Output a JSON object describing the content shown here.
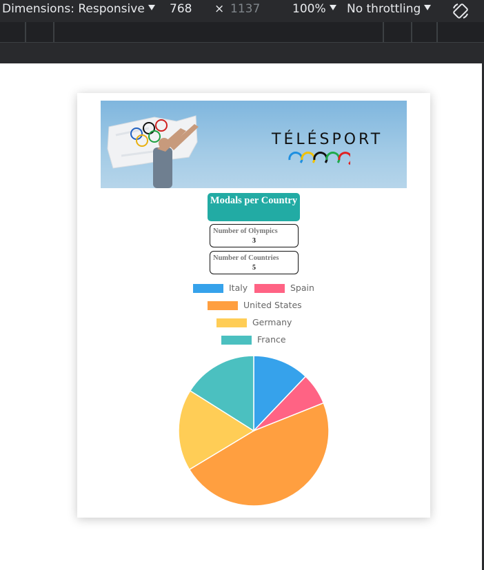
{
  "devtools": {
    "dimensions_label": "Dimensions: Responsive",
    "width": "768",
    "times": "×",
    "height": "1137",
    "zoom": "100%",
    "throttling": "No throttling"
  },
  "banner": {
    "brand": "TÉLÉSPORT"
  },
  "page": {
    "title": "Modals per Country",
    "stats": [
      {
        "label": "Number of Olympics",
        "value": "3"
      },
      {
        "label": "Number of Countries",
        "value": "5"
      }
    ]
  },
  "chart_data": {
    "type": "pie",
    "categories": [
      "Italy",
      "Spain",
      "United States",
      "Germany",
      "France"
    ],
    "values": [
      96,
      54,
      375,
      139,
      127
    ],
    "colors": [
      "#36a2eb",
      "#ff6384",
      "#ff9f40",
      "#ffcd56",
      "#4bc0c0"
    ],
    "title": "",
    "legend_position": "top"
  }
}
